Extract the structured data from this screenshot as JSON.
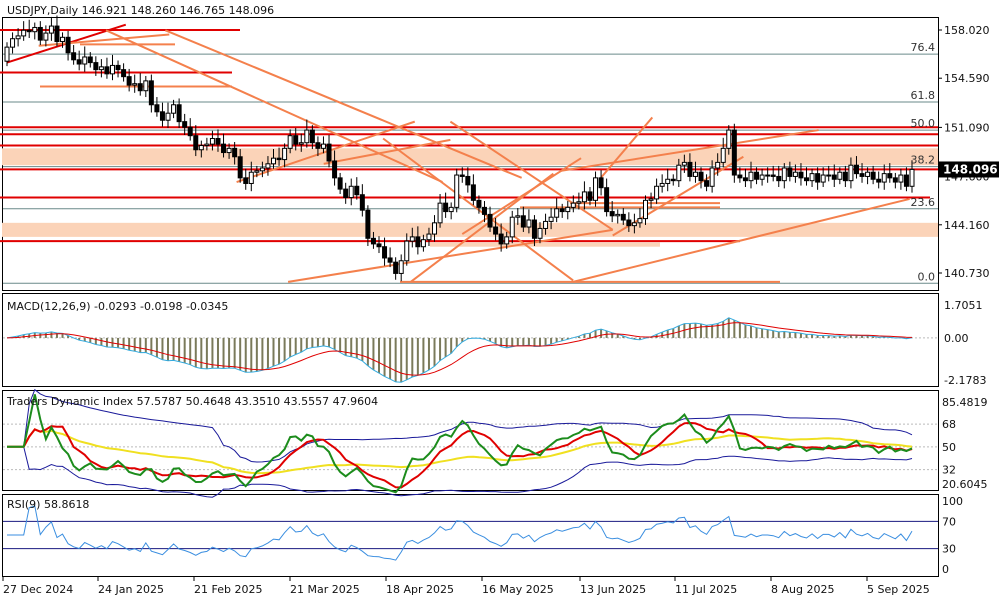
{
  "chart_data": {
    "type": "candlestick",
    "symbol_header": "USDJPY,Daily  146.921 148.260 146.765 148.096",
    "price_axis": {
      "labels": [
        "158.020",
        "154.590",
        "151.090",
        "147.600",
        "144.160",
        "140.730"
      ],
      "current_price": "148.096",
      "current_color": "#000000"
    },
    "fibonacci": {
      "levels": [
        {
          "label": "76.4",
          "price": 156.3
        },
        {
          "label": "61.8",
          "price": 152.9
        },
        {
          "label": "50.0",
          "price": 150.9
        },
        {
          "label": "38.2",
          "price": 148.3
        },
        {
          "label": "23.6",
          "price": 145.3
        },
        {
          "label": "0.0",
          "price": 140.0
        }
      ]
    },
    "date_labels": [
      "27 Dec 2024",
      "24 Jan 2025",
      "21 Feb 2025",
      "21 Mar 2025",
      "18 Apr 2025",
      "16 May 2025",
      "13 Jun 2025",
      "11 Jul 2025",
      "8 Aug 2025",
      "5 Sep 2025"
    ],
    "candles_close": [
      156.8,
      157.4,
      157.6,
      158.0,
      157.9,
      158.2,
      157.3,
      157.8,
      158.3,
      157.2,
      157.5,
      156.4,
      155.9,
      155.6,
      156.1,
      155.7,
      155.2,
      155.4,
      154.9,
      155.5,
      155.2,
      154.7,
      154.1,
      154.2,
      153.7,
      154.4,
      152.7,
      152.2,
      151.6,
      152.1,
      152.7,
      151.5,
      151.1,
      150.5,
      149.5,
      149.8,
      149.9,
      150.3,
      149.9,
      149.3,
      149.6,
      149.0,
      147.5,
      147.1,
      147.9,
      148.0,
      148.2,
      148.5,
      148.9,
      148.8,
      149.6,
      150.5,
      149.9,
      150.0,
      150.9,
      150.0,
      149.6,
      149.9,
      148.7,
      147.5,
      146.7,
      146.1,
      146.9,
      146.3,
      145.2,
      143.2,
      142.8,
      142.6,
      141.8,
      141.5,
      140.7,
      141.6,
      143.0,
      143.3,
      142.6,
      143.1,
      143.5,
      144.3,
      145.7,
      145.1,
      145.4,
      147.7,
      147.6,
      147.0,
      145.9,
      145.4,
      144.9,
      144.0,
      143.5,
      142.8,
      143.3,
      144.7,
      144.8,
      144.0,
      144.5,
      143.2,
      143.9,
      144.4,
      144.7,
      145.3,
      145.1,
      145.4,
      145.7,
      145.8,
      146.5,
      145.9,
      147.5,
      146.8,
      145.1,
      144.8,
      144.9,
      144.5,
      144.1,
      144.3,
      144.6,
      145.9,
      146.0,
      146.9,
      147.1,
      147.4,
      147.3,
      148.4,
      148.6,
      147.6,
      147.9,
      147.3,
      146.9,
      148.2,
      148.6,
      149.6,
      150.9,
      147.7,
      147.5,
      147.3,
      147.9,
      147.4,
      147.7,
      147.7,
      147.6,
      147.3,
      148.2,
      147.6,
      147.9,
      147.5,
      147.3,
      147.8,
      147.2,
      147.7,
      147.7,
      147.4,
      147.9,
      147.3,
      148.4,
      147.8,
      147.6,
      147.9,
      147.4,
      147.2,
      147.8,
      147.5,
      147.2,
      147.7,
      146.9,
      148.1
    ]
  },
  "macd": {
    "label": "MACD(12,26,9) -0.0293 -0.0198 -0.0345",
    "axis_labels": [
      "1.7051",
      "0.00",
      "-2.1783"
    ]
  },
  "tdi": {
    "label": "Traders Dynamic Index 57.5787 50.4648 43.3510 43.5557 47.9604",
    "axis_labels": [
      "85.4819",
      "68",
      "50",
      "32",
      "20.6045"
    ]
  },
  "rsi": {
    "label": "RSI(9) 58.8618",
    "axis_labels": [
      "100",
      "70",
      "30",
      "0"
    ]
  },
  "colors": {
    "up": "#000000",
    "down": "#000000",
    "support_resistance": "#e00000",
    "zone": "#fbd3b8",
    "trendline": "#f4804c",
    "macd_signal": "#e00000",
    "macd_line": "#33aadd",
    "tdi_band": "#1a1a9a",
    "tdi_green": "#1c8c1c",
    "tdi_red": "#e00000",
    "tdi_yellow": "#f0e020",
    "rsi_line": "#3a8ee0",
    "rsi_levels": "#1a1a80"
  }
}
